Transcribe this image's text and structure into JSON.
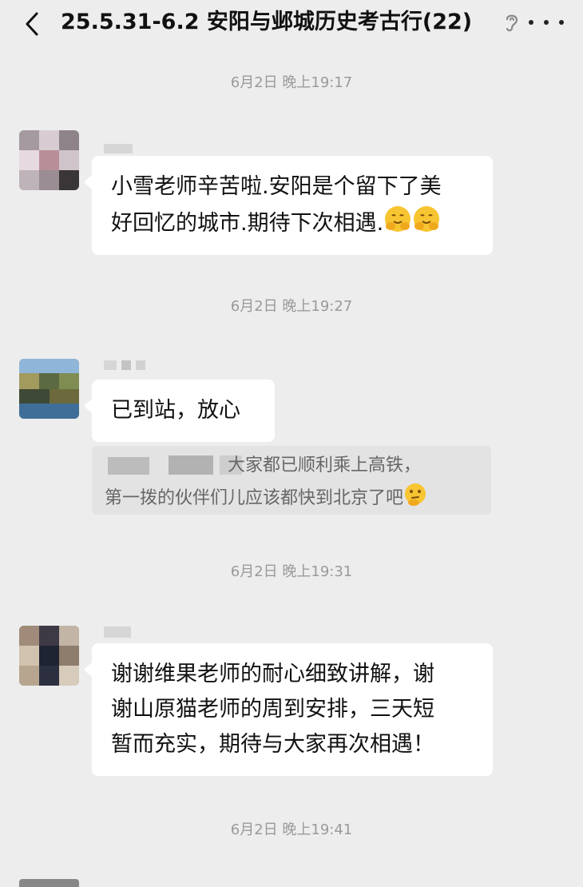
{
  "header": {
    "title": "25.5.31-6.2 安阳与邺城历史考古行(22)"
  },
  "icons": {
    "back": "chevron-left-icon",
    "ear": "ear-icon",
    "more": "more-horizontal-icon",
    "emoji": "hug-face-emoji",
    "thinking_emoji": "thinking-face-emoji"
  },
  "messages": [
    {
      "time": "6月2日 晚上19:17",
      "lines": [
        "小雪老师辛苦啦.安阳是个留下了美",
        "好回忆的城市.期待下次相遇."
      ]
    },
    {
      "time": "6月2日 晚上19:27",
      "lines": [
        "已到站，放心"
      ],
      "quote": {
        "line1": "大家都已顺利乘上高铁，",
        "line2": "第一拨的伙伴们儿应该都快到北京了吧"
      }
    },
    {
      "time": "6月2日 晚上19:31",
      "lines": [
        "谢谢维果老师的耐心细致讲解，谢",
        "谢山原猫老师的周到安排，三天短",
        "暂而充实，期待与大家再次相遇！"
      ]
    }
  ],
  "last_time": "6月2日 晚上19:41"
}
